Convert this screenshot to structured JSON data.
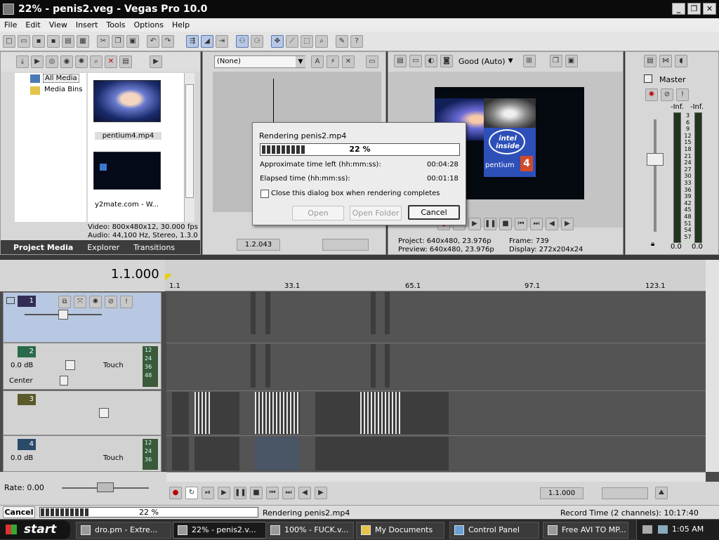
{
  "window": {
    "title": "22% - penis2.veg - Vegas Pro 10.0"
  },
  "menu": [
    "File",
    "Edit",
    "View",
    "Insert",
    "Tools",
    "Options",
    "Help"
  ],
  "project_media": {
    "tree": [
      "All Media",
      "Media Bins"
    ],
    "files": [
      "pentium4.mp4",
      "y2mate.com - W..."
    ],
    "info_video": "Video: 800x480x12, 30.000 fps",
    "info_audio": "Audio: 44,100 Hz, Stereo, 1.3.0",
    "tabs": [
      "Project Media",
      "Explorer",
      "Transitions"
    ]
  },
  "trimmer": {
    "select": "(None)",
    "position": "1.2.043"
  },
  "preview": {
    "quality": "Good (Auto)",
    "project": "Project:  640x480, 23.976p",
    "preview_info": "Preview:  640x480, 23.976p",
    "frame": "Frame:       739",
    "display": "Display:    272x204x24",
    "logo_text": "intel inside",
    "logo_brand": "pentium",
    "logo_num": "4"
  },
  "master": {
    "label": "Master",
    "left_peak": "-Inf.",
    "right_peak": "-Inf.",
    "scale": [
      "3",
      "6",
      "9",
      "12",
      "15",
      "18",
      "21",
      "24",
      "27",
      "30",
      "33",
      "36",
      "39",
      "42",
      "45",
      "48",
      "51",
      "54",
      "57"
    ],
    "bottom_left": "0.0",
    "bottom_right": "0.0"
  },
  "dialog": {
    "title": "Rendering penis2.mp4",
    "progress": 0.22,
    "progress_text": "22 %",
    "time_left_label": "Approximate time left (hh:mm:ss):",
    "time_left": "00:04:28",
    "elapsed_label": "Elapsed time (hh:mm:ss):",
    "elapsed": "00:01:18",
    "checkbox_label": "Close this dialog box when rendering completes",
    "open": "Open",
    "open_folder": "Open Folder",
    "cancel": "Cancel"
  },
  "timeline": {
    "position": "1.1.000",
    "ruler": [
      "1.1",
      "33.1",
      "65.1",
      "97.1",
      "123.1"
    ],
    "tracks": [
      {
        "num": "1",
        "type": "video"
      },
      {
        "num": "2",
        "type": "audio",
        "volume": "0.0 dB",
        "pan": "Center",
        "mode": "Touch",
        "meter": [
          "12",
          "24",
          "36",
          "48"
        ]
      },
      {
        "num": "3",
        "type": "video"
      },
      {
        "num": "4",
        "type": "audio",
        "volume": "0.0 dB",
        "mode": "Touch",
        "meter": [
          "12",
          "24",
          "36"
        ]
      }
    ],
    "rate": "Rate: 0.00",
    "transport_position": "1.1.000"
  },
  "status": {
    "cancel": "Cancel",
    "progress": 0.22,
    "progress_text": "22 %",
    "message": "Rendering penis2.mp4",
    "record_time": "Record Time (2 channels): 10:17:40"
  },
  "taskbar": {
    "start": "start",
    "tasks": [
      "dro.pm - Extre...",
      "22% - penis2.v...",
      "100% - FUCK.v...",
      "My Documents",
      "Control Panel",
      "Free AVI TO MP..."
    ],
    "clock": "1:05 AM"
  }
}
